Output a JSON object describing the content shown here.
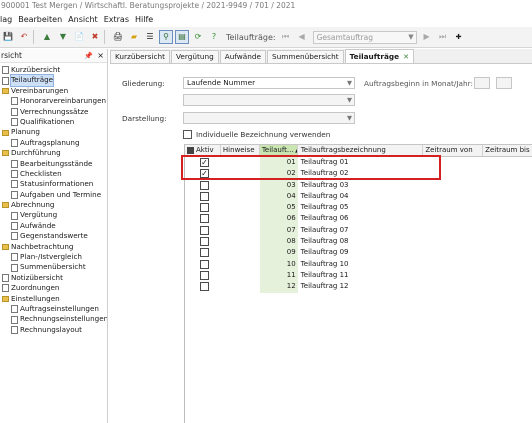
{
  "title": "900001 Test Mergen / Wirtschaftl. Beratungsprojekte / 2021-9949 / 701 / 2021",
  "menu": [
    "lag",
    "Bearbeiten",
    "Ansicht",
    "Extras",
    "Hilfe"
  ],
  "toolbar": {
    "teilauftraege_label": "Teilaufträge:",
    "combo_value": "Gesamtauftrag"
  },
  "sidebar": {
    "header": "rsicht",
    "items": [
      {
        "label": "Kurzübersicht",
        "level": 1,
        "icon": "document-icon"
      },
      {
        "label": "Teilaufträge",
        "level": 1,
        "icon": "document-icon"
      },
      {
        "label": "Vereinbarungen",
        "level": 1,
        "icon": "folder-icon"
      },
      {
        "label": "Honorarvereinbarungen",
        "level": 2,
        "icon": "document-icon"
      },
      {
        "label": "Verrechnungssätze",
        "level": 2,
        "icon": "document-icon"
      },
      {
        "label": "Qualifikationen",
        "level": 2,
        "icon": "document-icon"
      },
      {
        "label": "Planung",
        "level": 1,
        "icon": "folder-icon"
      },
      {
        "label": "Auftragsplanung",
        "level": 2,
        "icon": "document-icon"
      },
      {
        "label": "Durchführung",
        "level": 1,
        "icon": "folder-icon"
      },
      {
        "label": "Bearbeitungsstände",
        "level": 2,
        "icon": "document-icon"
      },
      {
        "label": "Checklisten",
        "level": 2,
        "icon": "document-icon"
      },
      {
        "label": "Statusinformationen",
        "level": 2,
        "icon": "document-icon"
      },
      {
        "label": "Aufgaben und Termine",
        "level": 2,
        "icon": "document-icon"
      },
      {
        "label": "Abrechnung",
        "level": 1,
        "icon": "folder-icon"
      },
      {
        "label": "Vergütung",
        "level": 2,
        "icon": "document-icon"
      },
      {
        "label": "Aufwände",
        "level": 2,
        "icon": "document-icon"
      },
      {
        "label": "Gegenstandswerte",
        "level": 2,
        "icon": "document-icon"
      },
      {
        "label": "Nachbetrachtung",
        "level": 1,
        "icon": "folder-icon"
      },
      {
        "label": "Plan-/Istvergleich",
        "level": 2,
        "icon": "document-icon"
      },
      {
        "label": "Summenübersicht",
        "level": 2,
        "icon": "document-icon"
      },
      {
        "label": "Notizübersicht",
        "level": 1,
        "icon": "document-icon"
      },
      {
        "label": "Zuordnungen",
        "level": 1,
        "icon": "document-icon"
      },
      {
        "label": "Einstellungen",
        "level": 1,
        "icon": "folder-icon"
      },
      {
        "label": "Auftragseinstellungen",
        "level": 2,
        "icon": "document-icon"
      },
      {
        "label": "Rechnungseinstellungen",
        "level": 2,
        "icon": "document-icon"
      },
      {
        "label": "Rechnungslayout",
        "level": 2,
        "icon": "document-icon"
      }
    ],
    "selected_index": 1
  },
  "tabs": [
    {
      "label": "Kurzübersicht",
      "active": false
    },
    {
      "label": "Vergütung",
      "active": false
    },
    {
      "label": "Aufwände",
      "active": false
    },
    {
      "label": "Summenübersicht",
      "active": false
    },
    {
      "label": "Teilaufträge",
      "active": true
    }
  ],
  "form": {
    "gliederung_label": "Gliederung:",
    "gliederung_value": "Laufende Nummer",
    "auftragsbeginn_label": "Auftragsbeginn in Monat/Jahr:",
    "darstellung_label": "Darstellung:",
    "individuelle_label": "Individuelle Bezeichnung verwenden"
  },
  "grid": {
    "columns": [
      "Aktiv",
      "Hinweise",
      "Teilauft...",
      "Teilauftragsbezeichnung",
      "Zeitraum von",
      "Zeitraum bis"
    ],
    "rows": [
      {
        "aktiv": true,
        "nr": "01",
        "bez": "Teilauftrag 01"
      },
      {
        "aktiv": true,
        "nr": "02",
        "bez": "Teilauftrag 02"
      },
      {
        "aktiv": false,
        "nr": "03",
        "bez": "Teilauftrag 03"
      },
      {
        "aktiv": false,
        "nr": "04",
        "bez": "Teilauftrag 04"
      },
      {
        "aktiv": false,
        "nr": "05",
        "bez": "Teilauftrag 05"
      },
      {
        "aktiv": false,
        "nr": "06",
        "bez": "Teilauftrag 06"
      },
      {
        "aktiv": false,
        "nr": "07",
        "bez": "Teilauftrag 07"
      },
      {
        "aktiv": false,
        "nr": "08",
        "bez": "Teilauftrag 08"
      },
      {
        "aktiv": false,
        "nr": "09",
        "bez": "Teilauftrag 09"
      },
      {
        "aktiv": false,
        "nr": "10",
        "bez": "Teilauftrag 10"
      },
      {
        "aktiv": false,
        "nr": "11",
        "bez": "Teilauftrag 11"
      },
      {
        "aktiv": false,
        "nr": "12",
        "bez": "Teilauftrag 12"
      }
    ]
  },
  "colors": {
    "highlight": "#d42020",
    "sorted_column": "#c9e6b2",
    "tab_close": "#3a8a3a"
  }
}
